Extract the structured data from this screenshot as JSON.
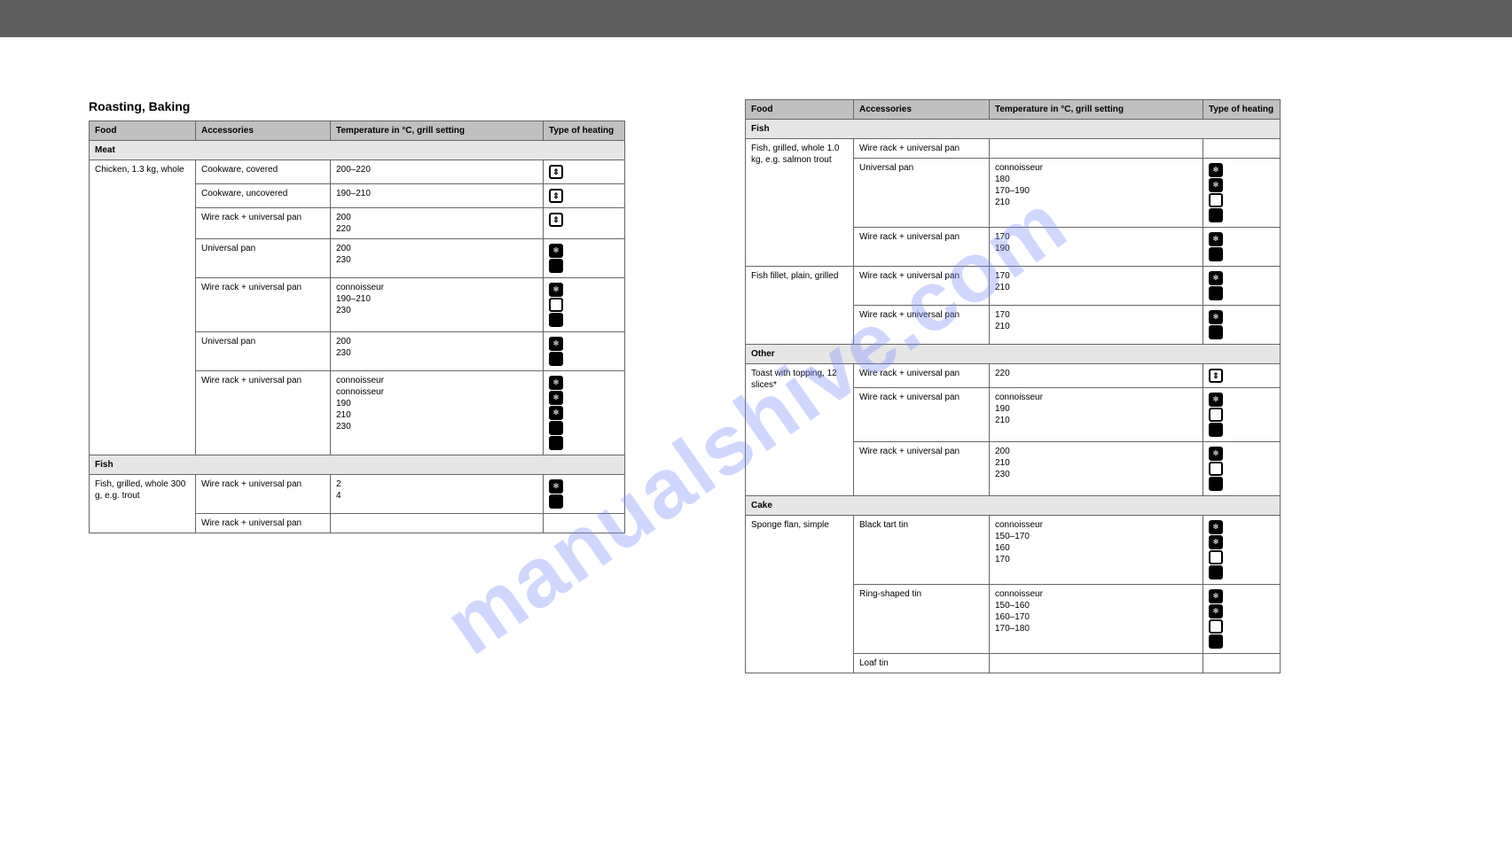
{
  "meta": {
    "watermark": "manualshive.com"
  },
  "left": {
    "heading": "Roasting, Baking",
    "columns": [
      "Food",
      "Accessories",
      "Temperature in °C, grill setting",
      "Type of heating"
    ],
    "sections": [
      {
        "title": "Meat",
        "rows": [
          {
            "food": "Chicken, 1.3 kg, whole",
            "acc": "Cookware, covered",
            "temp": "200–220",
            "icons": [
              {
                "t": "var"
              }
            ]
          },
          {
            "food": "",
            "acc": "Cookware, uncovered",
            "temp": "190–210",
            "icons": [
              {
                "t": "var"
              }
            ]
          },
          {
            "food": "",
            "acc": "Wire rack + universal pan",
            "temp": "200\n220",
            "icons": [
              {
                "t": "var"
              }
            ]
          },
          {
            "food": "",
            "acc": "Universal pan",
            "temp": "200\n230",
            "icons": [
              {
                "t": "fan"
              },
              {
                "t": "solid"
              }
            ]
          },
          {
            "food": "",
            "acc": "Wire rack + universal pan",
            "temp": "connoisseur\n190–210\n230",
            "icons": [
              {
                "t": "fan"
              },
              {
                "t": "outline"
              },
              {
                "t": "solid"
              }
            ]
          },
          {
            "food": "",
            "acc": "Universal pan",
            "temp": "200\n230",
            "icons": [
              {
                "t": "fan"
              },
              {
                "t": "solid"
              }
            ]
          },
          {
            "food": "",
            "acc": "Wire rack + universal pan",
            "temp": "connoisseur\nconnoisseur\n190\n210\n230",
            "icons": [
              {
                "t": "fan"
              },
              {
                "t": "fan"
              },
              {
                "t": "fan"
              },
              {
                "t": "solid"
              },
              {
                "t": "solid"
              }
            ]
          }
        ]
      },
      {
        "title": "Fish",
        "rows": [
          {
            "food": "Fish, grilled, whole 300 g, e.g. trout",
            "acc": "Wire rack + universal pan",
            "temp": "2\n4",
            "icons": [
              {
                "t": "fan"
              },
              {
                "t": "solid"
              }
            ]
          },
          {
            "food": "",
            "acc": "Wire rack + universal pan",
            "temp": "",
            "icons": []
          }
        ]
      }
    ]
  },
  "right": {
    "columns": [
      "Food",
      "Accessories",
      "Temperature in °C, grill setting",
      "Type of heating"
    ],
    "sections": [
      {
        "title": "Fish",
        "rows": [
          {
            "food": "Fish, grilled, whole 1.0 kg, e.g. salmon trout",
            "acc": "Wire rack + universal pan",
            "temp": "",
            "icons": []
          },
          {
            "food": "",
            "acc": "Universal pan",
            "temp": "connoisseur\n180\n170–190\n210",
            "icons": [
              {
                "t": "fan"
              },
              {
                "t": "fan"
              },
              {
                "t": "outline"
              },
              {
                "t": "solid"
              }
            ]
          },
          {
            "food": "",
            "acc": "Wire rack + universal pan",
            "temp": "170\n190",
            "icons": [
              {
                "t": "fan"
              },
              {
                "t": "solid"
              }
            ]
          },
          {
            "food": "Fish fillet, plain, grilled",
            "acc": "Wire rack + universal pan",
            "temp": "170\n210",
            "icons": [
              {
                "t": "fan"
              },
              {
                "t": "solid"
              }
            ]
          },
          {
            "food": "",
            "acc": "Wire rack + universal pan",
            "temp": "170\n210",
            "icons": [
              {
                "t": "fan"
              },
              {
                "t": "solid"
              }
            ]
          }
        ]
      },
      {
        "title": "Other",
        "rows": [
          {
            "food": "Toast with topping, 12 slices*",
            "acc": "Wire rack + universal pan",
            "temp": "220",
            "icons": [
              {
                "t": "var"
              }
            ]
          },
          {
            "food": "",
            "acc": "Wire rack + universal pan",
            "temp": "connoisseur\n190\n210",
            "icons": [
              {
                "t": "fan"
              },
              {
                "t": "outline"
              },
              {
                "t": "solid"
              }
            ]
          },
          {
            "food": "",
            "acc": "Wire rack + universal pan",
            "temp": "200\n210\n230",
            "icons": [
              {
                "t": "fan"
              },
              {
                "t": "outline"
              },
              {
                "t": "solid"
              }
            ]
          }
        ]
      },
      {
        "title": "Cake",
        "rows": [
          {
            "food": "Sponge flan, simple",
            "acc": "Black tart tin",
            "temp": "connoisseur\n150–170\n160\n170",
            "icons": [
              {
                "t": "fan"
              },
              {
                "t": "fan"
              },
              {
                "t": "outline"
              },
              {
                "t": "solid"
              }
            ]
          },
          {
            "food": "",
            "acc": "Ring-shaped tin",
            "temp": "connoisseur\n150–160\n160–170\n170–180",
            "icons": [
              {
                "t": "fan"
              },
              {
                "t": "fan"
              },
              {
                "t": "outline"
              },
              {
                "t": "solid"
              }
            ]
          },
          {
            "food": "",
            "acc": "Loaf tin",
            "temp": "",
            "icons": []
          }
        ]
      }
    ]
  }
}
